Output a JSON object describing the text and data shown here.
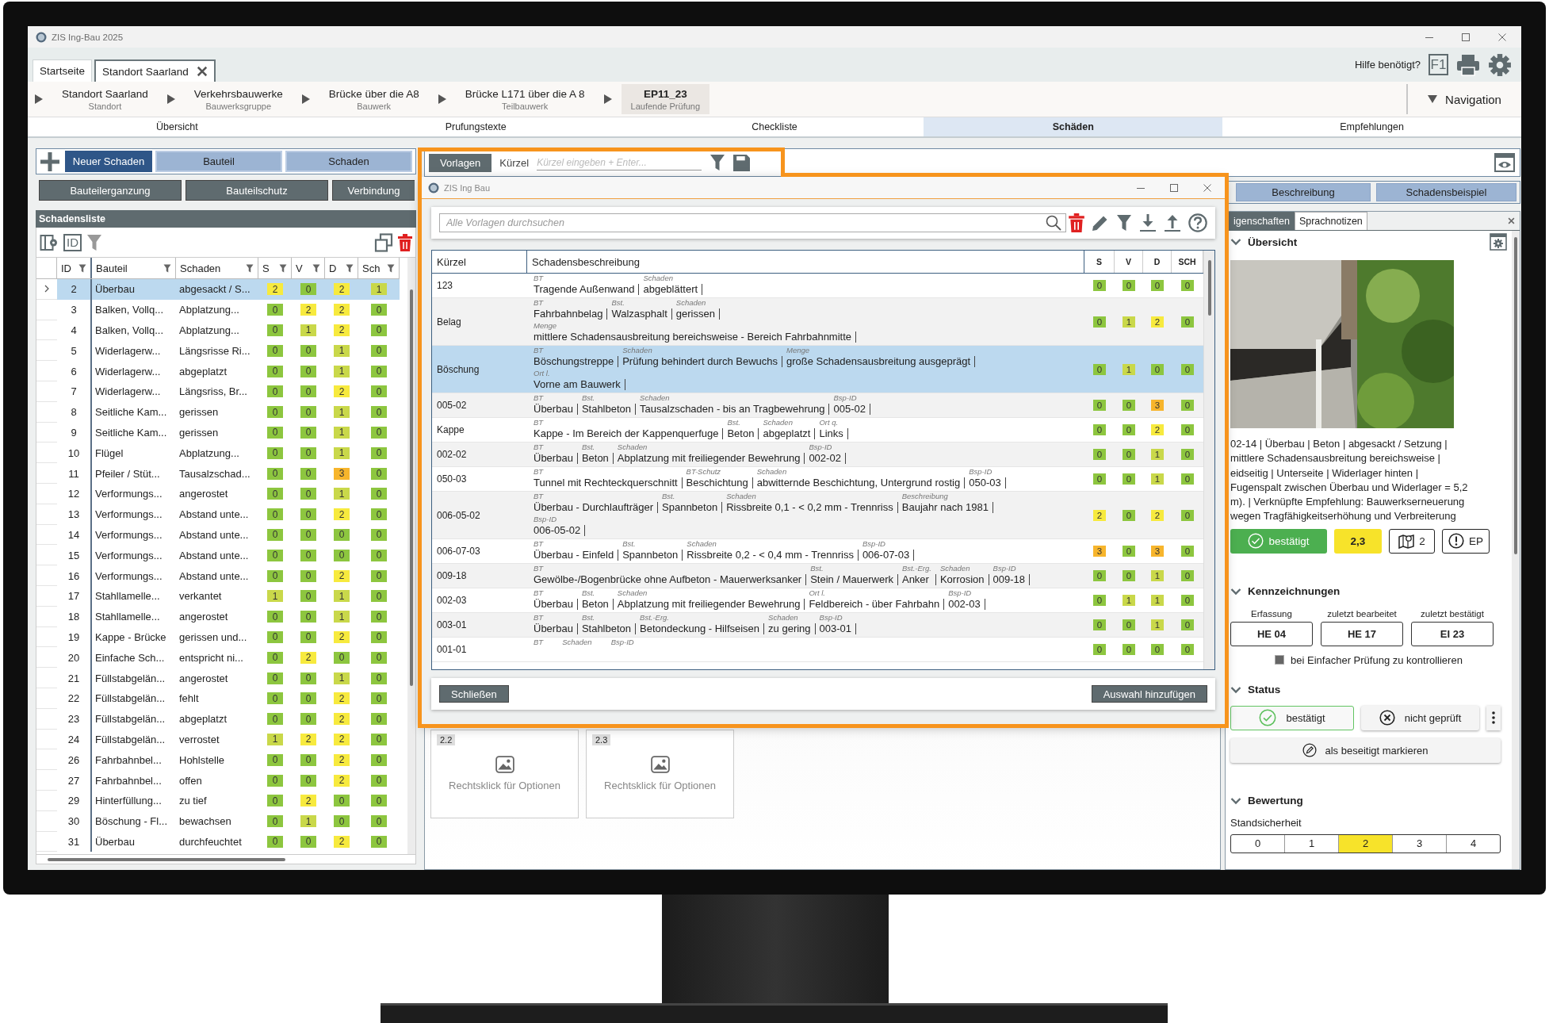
{
  "window": {
    "title": "ZIS Ing-Bau 2025"
  },
  "doc_tabs": [
    {
      "label": "Startseite",
      "selected": false,
      "closable": false
    },
    {
      "label": "Standort Saarland",
      "selected": true,
      "closable": true
    }
  ],
  "help": {
    "label": "Hilfe benötigt?",
    "key": "F1"
  },
  "breadcrumb": [
    {
      "title": "Standort Saarland",
      "subtitle": "Standort",
      "selected": false
    },
    {
      "title": "Verkehrsbauwerke",
      "subtitle": "Bauwerksgruppe",
      "selected": false
    },
    {
      "title": "Brücke über die A8",
      "subtitle": "Bauwerk",
      "selected": false
    },
    {
      "title": "Brücke L171 über die A 8",
      "subtitle": "Teilbauwerk",
      "selected": false
    },
    {
      "title": "EP11_23",
      "subtitle": "Laufende Prüfung",
      "selected": true
    }
  ],
  "navigation": {
    "label": "Navigation"
  },
  "nav_tabs": [
    {
      "label": "Übersicht",
      "selected": false
    },
    {
      "label": "Prufungstexte",
      "selected": false
    },
    {
      "label": "Checkliste",
      "selected": false
    },
    {
      "label": "Schäden",
      "selected": true
    },
    {
      "label": "Empfehlungen",
      "selected": false
    }
  ],
  "left_toolbar": {
    "primary": "Neuer Schaden",
    "row_1": [
      "Bauteil",
      "Schaden"
    ],
    "row_2": [
      "Bauteilerganzung",
      "Bauteilschutz",
      "Verbindung"
    ]
  },
  "damage_list": {
    "title": "Schadensliste",
    "id_toggle": "ID",
    "columns": [
      "ID",
      "Bauteil",
      "Schaden",
      "S",
      "V",
      "D",
      "Sch"
    ],
    "rows": [
      {
        "id": "2",
        "bauteil": "Überbau",
        "schaden": "abgesackt / S...",
        "selected": true,
        "ratings": [
          {
            "value": "2",
            "color": "#f7ea3e"
          },
          {
            "value": "0",
            "color": "#8dc63f"
          },
          {
            "value": "2",
            "color": "#f7ea3e"
          },
          {
            "value": "1",
            "color": "#c9d84a"
          }
        ]
      },
      {
        "id": "3",
        "bauteil": "Balken, Vollq...",
        "schaden": "Abplatzung...",
        "selected": false,
        "ratings": [
          {
            "value": "0",
            "color": "#8dc63f"
          },
          {
            "value": "2",
            "color": "#f7ea3e"
          },
          {
            "value": "2",
            "color": "#f7ea3e"
          },
          {
            "value": "0",
            "color": "#8dc63f"
          }
        ]
      },
      {
        "id": "4",
        "bauteil": "Balken, Vollq...",
        "schaden": "Abplatzung...",
        "selected": false,
        "ratings": [
          {
            "value": "0",
            "color": "#8dc63f"
          },
          {
            "value": "1",
            "color": "#c9d84a"
          },
          {
            "value": "2",
            "color": "#f7ea3e"
          },
          {
            "value": "0",
            "color": "#8dc63f"
          }
        ]
      },
      {
        "id": "5",
        "bauteil": "Widerlagerw...",
        "schaden": "Längsrisse Ri...",
        "selected": false,
        "ratings": [
          {
            "value": "0",
            "color": "#8dc63f"
          },
          {
            "value": "0",
            "color": "#8dc63f"
          },
          {
            "value": "1",
            "color": "#c9d84a"
          },
          {
            "value": "0",
            "color": "#8dc63f"
          }
        ]
      },
      {
        "id": "6",
        "bauteil": "Widerlagerw...",
        "schaden": "abgeplatzt",
        "selected": false,
        "ratings": [
          {
            "value": "0",
            "color": "#8dc63f"
          },
          {
            "value": "0",
            "color": "#8dc63f"
          },
          {
            "value": "1",
            "color": "#c9d84a"
          },
          {
            "value": "0",
            "color": "#8dc63f"
          }
        ]
      },
      {
        "id": "7",
        "bauteil": "Widerlagerw...",
        "schaden": "Längsriss, Br...",
        "selected": false,
        "ratings": [
          {
            "value": "0",
            "color": "#8dc63f"
          },
          {
            "value": "0",
            "color": "#8dc63f"
          },
          {
            "value": "2",
            "color": "#f7ea3e"
          },
          {
            "value": "0",
            "color": "#8dc63f"
          }
        ]
      },
      {
        "id": "8",
        "bauteil": "Seitliche Kam...",
        "schaden": "gerissen",
        "selected": false,
        "ratings": [
          {
            "value": "0",
            "color": "#8dc63f"
          },
          {
            "value": "0",
            "color": "#8dc63f"
          },
          {
            "value": "1",
            "color": "#c9d84a"
          },
          {
            "value": "0",
            "color": "#8dc63f"
          }
        ]
      },
      {
        "id": "9",
        "bauteil": "Seitliche Kam...",
        "schaden": "gerissen",
        "selected": false,
        "ratings": [
          {
            "value": "0",
            "color": "#8dc63f"
          },
          {
            "value": "0",
            "color": "#8dc63f"
          },
          {
            "value": "1",
            "color": "#c9d84a"
          },
          {
            "value": "0",
            "color": "#8dc63f"
          }
        ]
      },
      {
        "id": "10",
        "bauteil": "Flügel",
        "schaden": "Abplatzung...",
        "selected": false,
        "ratings": [
          {
            "value": "0",
            "color": "#8dc63f"
          },
          {
            "value": "0",
            "color": "#8dc63f"
          },
          {
            "value": "1",
            "color": "#c9d84a"
          },
          {
            "value": "0",
            "color": "#8dc63f"
          }
        ]
      },
      {
        "id": "11",
        "bauteil": "Pfeiler / Stüt...",
        "schaden": "Tausalzschad...",
        "selected": false,
        "ratings": [
          {
            "value": "0",
            "color": "#8dc63f"
          },
          {
            "value": "0",
            "color": "#8dc63f"
          },
          {
            "value": "3",
            "color": "#f7b52c"
          },
          {
            "value": "0",
            "color": "#8dc63f"
          }
        ]
      },
      {
        "id": "12",
        "bauteil": "Verformungs...",
        "schaden": "angerostet",
        "selected": false,
        "ratings": [
          {
            "value": "0",
            "color": "#8dc63f"
          },
          {
            "value": "0",
            "color": "#8dc63f"
          },
          {
            "value": "1",
            "color": "#c9d84a"
          },
          {
            "value": "0",
            "color": "#8dc63f"
          }
        ]
      },
      {
        "id": "13",
        "bauteil": "Verformungs...",
        "schaden": "Abstand unte...",
        "selected": false,
        "ratings": [
          {
            "value": "0",
            "color": "#8dc63f"
          },
          {
            "value": "0",
            "color": "#8dc63f"
          },
          {
            "value": "2",
            "color": "#f7ea3e"
          },
          {
            "value": "0",
            "color": "#8dc63f"
          }
        ]
      },
      {
        "id": "14",
        "bauteil": "Verformungs...",
        "schaden": "Abstand unte...",
        "selected": false,
        "ratings": [
          {
            "value": "0",
            "color": "#8dc63f"
          },
          {
            "value": "0",
            "color": "#8dc63f"
          },
          {
            "value": "0",
            "color": "#8dc63f"
          },
          {
            "value": "0",
            "color": "#8dc63f"
          }
        ]
      },
      {
        "id": "15",
        "bauteil": "Verformungs...",
        "schaden": "Abstand unte...",
        "selected": false,
        "ratings": [
          {
            "value": "0",
            "color": "#8dc63f"
          },
          {
            "value": "0",
            "color": "#8dc63f"
          },
          {
            "value": "0",
            "color": "#8dc63f"
          },
          {
            "value": "0",
            "color": "#8dc63f"
          }
        ]
      },
      {
        "id": "16",
        "bauteil": "Verformungs...",
        "schaden": "Abstand unte...",
        "selected": false,
        "ratings": [
          {
            "value": "0",
            "color": "#8dc63f"
          },
          {
            "value": "0",
            "color": "#8dc63f"
          },
          {
            "value": "2",
            "color": "#f7ea3e"
          },
          {
            "value": "0",
            "color": "#8dc63f"
          }
        ]
      },
      {
        "id": "17",
        "bauteil": "Stahllamelle...",
        "schaden": "verkantet",
        "selected": false,
        "ratings": [
          {
            "value": "1",
            "color": "#c9d84a"
          },
          {
            "value": "0",
            "color": "#8dc63f"
          },
          {
            "value": "1",
            "color": "#c9d84a"
          },
          {
            "value": "0",
            "color": "#8dc63f"
          }
        ]
      },
      {
        "id": "18",
        "bauteil": "Stahllamelle...",
        "schaden": "angerostet",
        "selected": false,
        "ratings": [
          {
            "value": "0",
            "color": "#8dc63f"
          },
          {
            "value": "0",
            "color": "#8dc63f"
          },
          {
            "value": "1",
            "color": "#c9d84a"
          },
          {
            "value": "0",
            "color": "#8dc63f"
          }
        ]
      },
      {
        "id": "19",
        "bauteil": "Kappe - Brücke",
        "schaden": "gerissen und...",
        "selected": false,
        "ratings": [
          {
            "value": "0",
            "color": "#8dc63f"
          },
          {
            "value": "0",
            "color": "#8dc63f"
          },
          {
            "value": "2",
            "color": "#f7ea3e"
          },
          {
            "value": "0",
            "color": "#8dc63f"
          }
        ]
      },
      {
        "id": "20",
        "bauteil": "Einfache Sch...",
        "schaden": "entspricht ni...",
        "selected": false,
        "ratings": [
          {
            "value": "0",
            "color": "#8dc63f"
          },
          {
            "value": "2",
            "color": "#f7ea3e"
          },
          {
            "value": "0",
            "color": "#8dc63f"
          },
          {
            "value": "0",
            "color": "#8dc63f"
          }
        ]
      },
      {
        "id": "21",
        "bauteil": "Füllstabgelän...",
        "schaden": "angerostet",
        "selected": false,
        "ratings": [
          {
            "value": "0",
            "color": "#8dc63f"
          },
          {
            "value": "0",
            "color": "#8dc63f"
          },
          {
            "value": "1",
            "color": "#c9d84a"
          },
          {
            "value": "0",
            "color": "#8dc63f"
          }
        ]
      },
      {
        "id": "22",
        "bauteil": "Füllstabgelän...",
        "schaden": "fehlt",
        "selected": false,
        "ratings": [
          {
            "value": "0",
            "color": "#8dc63f"
          },
          {
            "value": "0",
            "color": "#8dc63f"
          },
          {
            "value": "2",
            "color": "#f7ea3e"
          },
          {
            "value": "0",
            "color": "#8dc63f"
          }
        ]
      },
      {
        "id": "23",
        "bauteil": "Füllstabgelän...",
        "schaden": "abgeplatzt",
        "selected": false,
        "ratings": [
          {
            "value": "0",
            "color": "#8dc63f"
          },
          {
            "value": "0",
            "color": "#8dc63f"
          },
          {
            "value": "2",
            "color": "#f7ea3e"
          },
          {
            "value": "0",
            "color": "#8dc63f"
          }
        ]
      },
      {
        "id": "24",
        "bauteil": "Füllstabgelän...",
        "schaden": "verrostet",
        "selected": false,
        "ratings": [
          {
            "value": "1",
            "color": "#c9d84a"
          },
          {
            "value": "2",
            "color": "#f7ea3e"
          },
          {
            "value": "2",
            "color": "#f7ea3e"
          },
          {
            "value": "0",
            "color": "#8dc63f"
          }
        ]
      },
      {
        "id": "26",
        "bauteil": "Fahrbahnbel...",
        "schaden": "Hohlstelle",
        "selected": false,
        "ratings": [
          {
            "value": "0",
            "color": "#8dc63f"
          },
          {
            "value": "0",
            "color": "#8dc63f"
          },
          {
            "value": "2",
            "color": "#f7ea3e"
          },
          {
            "value": "0",
            "color": "#8dc63f"
          }
        ]
      },
      {
        "id": "27",
        "bauteil": "Fahrbahnbel...",
        "schaden": "offen",
        "selected": false,
        "ratings": [
          {
            "value": "0",
            "color": "#8dc63f"
          },
          {
            "value": "0",
            "color": "#8dc63f"
          },
          {
            "value": "2",
            "color": "#f7ea3e"
          },
          {
            "value": "0",
            "color": "#8dc63f"
          }
        ]
      },
      {
        "id": "29",
        "bauteil": "Hinterfüllung...",
        "schaden": "zu tief",
        "selected": false,
        "ratings": [
          {
            "value": "0",
            "color": "#8dc63f"
          },
          {
            "value": "2",
            "color": "#f7ea3e"
          },
          {
            "value": "0",
            "color": "#8dc63f"
          },
          {
            "value": "0",
            "color": "#8dc63f"
          }
        ]
      },
      {
        "id": "30",
        "bauteil": "Böschung - Fl...",
        "schaden": "bewachsen",
        "selected": false,
        "ratings": [
          {
            "value": "0",
            "color": "#8dc63f"
          },
          {
            "value": "1",
            "color": "#c9d84a"
          },
          {
            "value": "0",
            "color": "#8dc63f"
          },
          {
            "value": "0",
            "color": "#8dc63f"
          }
        ]
      },
      {
        "id": "31",
        "bauteil": "Überbau",
        "schaden": "durchfeuchtet",
        "selected": false,
        "ratings": [
          {
            "value": "0",
            "color": "#8dc63f"
          },
          {
            "value": "0",
            "color": "#8dc63f"
          },
          {
            "value": "2",
            "color": "#f7ea3e"
          },
          {
            "value": "0",
            "color": "#8dc63f"
          }
        ]
      }
    ]
  },
  "templates_bar": {
    "tab": "Vorlagen",
    "label": "Kürzel",
    "placeholder": "Kürzel eingeben + Enter..."
  },
  "detail_buttons": [
    "Beschreibung",
    "Schadensbeispiel"
  ],
  "image_slots": [
    {
      "number": "2.2",
      "hint": "Rechtsklick für Optionen"
    },
    {
      "number": "2.3",
      "hint": "Rechtsklick für Optionen"
    }
  ],
  "dialog": {
    "title": "ZIS Ing Bau",
    "search_placeholder": "Alle Vorlagen durchsuchen",
    "columns": [
      "Kürzel",
      "Schadensbeschreibung",
      "S",
      "V",
      "D",
      "SCH"
    ],
    "rows": [
      {
        "kuerzel": "123",
        "selected": false,
        "lines": [
          [
            {
              "label": "BT",
              "text": "Tragende Außenwand"
            },
            {
              "label": "Schaden",
              "text": "abgeblättert"
            }
          ]
        ],
        "ratings": [
          {
            "value": "0",
            "color": "#8dc63f"
          },
          {
            "value": "0",
            "color": "#8dc63f"
          },
          {
            "value": "0",
            "color": "#8dc63f"
          },
          {
            "value": "0",
            "color": "#8dc63f"
          }
        ]
      },
      {
        "kuerzel": "Belag",
        "selected": false,
        "lines": [
          [
            {
              "label": "BT",
              "text": "Fahrbahnbelag"
            },
            {
              "label": "Bst.",
              "text": "Walzasphalt"
            },
            {
              "label": "Schaden",
              "text": "gerissen"
            }
          ],
          [
            {
              "label": "Menge",
              "text": "mittlere Schadensausbreitung bereichsweise - Bereich Fahrbahnmitte"
            }
          ]
        ],
        "ratings": [
          {
            "value": "0",
            "color": "#8dc63f"
          },
          {
            "value": "1",
            "color": "#c9d84a"
          },
          {
            "value": "2",
            "color": "#f7ea3e"
          },
          {
            "value": "0",
            "color": "#8dc63f"
          }
        ]
      },
      {
        "kuerzel": "Böschung",
        "selected": true,
        "lines": [
          [
            {
              "label": "BT",
              "text": "Böschungstreppe"
            },
            {
              "label": "Schaden",
              "text": "Prüfung behindert durch Bewuchs"
            },
            {
              "label": "Menge",
              "text": "große Schadensausbreitung ausgeprägt"
            }
          ],
          [
            {
              "label": "Ort l.",
              "text": "Vorne am Bauwerk"
            }
          ]
        ],
        "ratings": [
          {
            "value": "0",
            "color": "#8dc63f"
          },
          {
            "value": "1",
            "color": "#c9d84a"
          },
          {
            "value": "0",
            "color": "#8dc63f"
          },
          {
            "value": "0",
            "color": "#8dc63f"
          }
        ]
      },
      {
        "kuerzel": "005-02",
        "selected": false,
        "lines": [
          [
            {
              "label": "BT",
              "text": "Überbau"
            },
            {
              "label": "Bst.",
              "text": "Stahlbeton"
            },
            {
              "label": "Schaden",
              "text": "Tausalzschaden - bis an Tragbewehrung"
            },
            {
              "label": "Bsp-ID",
              "text": "005-02"
            }
          ]
        ],
        "ratings": [
          {
            "value": "0",
            "color": "#8dc63f"
          },
          {
            "value": "0",
            "color": "#8dc63f"
          },
          {
            "value": "3",
            "color": "#f7b52c"
          },
          {
            "value": "0",
            "color": "#8dc63f"
          }
        ]
      },
      {
        "kuerzel": "Kappe",
        "selected": false,
        "lines": [
          [
            {
              "label": "BT",
              "text": "Kappe - Im Bereich der Kappenquerfuge"
            },
            {
              "label": "Bst.",
              "text": "Beton"
            },
            {
              "label": "Schaden",
              "text": "abgeplatzt"
            },
            {
              "label": "Ort q.",
              "text": "Links"
            }
          ]
        ],
        "ratings": [
          {
            "value": "0",
            "color": "#8dc63f"
          },
          {
            "value": "0",
            "color": "#8dc63f"
          },
          {
            "value": "2",
            "color": "#f7ea3e"
          },
          {
            "value": "0",
            "color": "#8dc63f"
          }
        ]
      },
      {
        "kuerzel": "002-02",
        "selected": false,
        "lines": [
          [
            {
              "label": "BT",
              "text": "Überbau"
            },
            {
              "label": "Bst.",
              "text": "Beton"
            },
            {
              "label": "Schaden",
              "text": "Abplatzung mit freiliegender Bewehrung"
            },
            {
              "label": "Bsp-ID",
              "text": "002-02"
            }
          ]
        ],
        "ratings": [
          {
            "value": "0",
            "color": "#8dc63f"
          },
          {
            "value": "0",
            "color": "#8dc63f"
          },
          {
            "value": "1",
            "color": "#c9d84a"
          },
          {
            "value": "0",
            "color": "#8dc63f"
          }
        ]
      },
      {
        "kuerzel": "050-03",
        "selected": false,
        "lines": [
          [
            {
              "label": "BT",
              "text": "Tunnel mit Rechteckquerschnitt"
            },
            {
              "label": "BT-Schutz",
              "text": "Beschichtung"
            },
            {
              "label": "Schaden",
              "text": "abwitternde Beschichtung, Untergrund rostig"
            },
            {
              "label": "Bsp-ID",
              "text": "050-03"
            }
          ]
        ],
        "ratings": [
          {
            "value": "0",
            "color": "#8dc63f"
          },
          {
            "value": "0",
            "color": "#8dc63f"
          },
          {
            "value": "1",
            "color": "#c9d84a"
          },
          {
            "value": "0",
            "color": "#8dc63f"
          }
        ]
      },
      {
        "kuerzel": "006-05-02",
        "selected": false,
        "lines": [
          [
            {
              "label": "BT",
              "text": "Überbau - Durchlaufträger"
            },
            {
              "label": "Bst.",
              "text": "Spannbeton"
            },
            {
              "label": "Schaden",
              "text": "Rissbreite 0,1 - < 0,2 mm - Trennriss"
            },
            {
              "label": "Beschreibung",
              "text": "Baujahr nach 1981"
            }
          ],
          [
            {
              "label": "Bsp-ID",
              "text": "006-05-02"
            }
          ]
        ],
        "ratings": [
          {
            "value": "2",
            "color": "#f7ea3e"
          },
          {
            "value": "0",
            "color": "#8dc63f"
          },
          {
            "value": "2",
            "color": "#f7ea3e"
          },
          {
            "value": "0",
            "color": "#8dc63f"
          }
        ]
      },
      {
        "kuerzel": "006-07-03",
        "selected": false,
        "lines": [
          [
            {
              "label": "BT",
              "text": "Überbau - Einfeld"
            },
            {
              "label": "Bst.",
              "text": "Spannbeton"
            },
            {
              "label": "Schaden",
              "text": "Rissbreite 0,2 - < 0,4 mm - Trennriss"
            },
            {
              "label": "Bsp-ID",
              "text": "006-07-03"
            }
          ]
        ],
        "ratings": [
          {
            "value": "3",
            "color": "#f7b52c"
          },
          {
            "value": "0",
            "color": "#8dc63f"
          },
          {
            "value": "3",
            "color": "#f7b52c"
          },
          {
            "value": "0",
            "color": "#8dc63f"
          }
        ]
      },
      {
        "kuerzel": "009-18",
        "selected": false,
        "lines": [
          [
            {
              "label": "BT",
              "text": "Gewölbe-/Bogenbrücke ohne Aufbeton - Mauerwerksanker"
            },
            {
              "label": "Bst.",
              "text": "Stein / Mauerwerk"
            },
            {
              "label": "Bst.-Erg.",
              "text": "Anker"
            },
            {
              "label": "Schaden",
              "text": "Korrosion"
            },
            {
              "label": "Bsp-ID",
              "text": "009-18"
            }
          ]
        ],
        "ratings": [
          {
            "value": "0",
            "color": "#8dc63f"
          },
          {
            "value": "0",
            "color": "#8dc63f"
          },
          {
            "value": "1",
            "color": "#c9d84a"
          },
          {
            "value": "0",
            "color": "#8dc63f"
          }
        ]
      },
      {
        "kuerzel": "002-03",
        "selected": false,
        "lines": [
          [
            {
              "label": "BT",
              "text": "Überbau"
            },
            {
              "label": "Bst.",
              "text": "Beton"
            },
            {
              "label": "Schaden",
              "text": "Abplatzung mit freiliegender Bewehrung"
            },
            {
              "label": "Ort l.",
              "text": "Feldbereich - über Fahrbahn"
            },
            {
              "label": "Bsp-ID",
              "text": "002-03"
            }
          ]
        ],
        "ratings": [
          {
            "value": "0",
            "color": "#8dc63f"
          },
          {
            "value": "1",
            "color": "#c9d84a"
          },
          {
            "value": "1",
            "color": "#c9d84a"
          },
          {
            "value": "0",
            "color": "#8dc63f"
          }
        ]
      },
      {
        "kuerzel": "003-01",
        "selected": false,
        "lines": [
          [
            {
              "label": "BT",
              "text": "Überbau"
            },
            {
              "label": "Bst.",
              "text": "Stahlbeton"
            },
            {
              "label": "Bst.-Erg.",
              "text": "Betondeckung - Hilfseisen"
            },
            {
              "label": "Schaden",
              "text": "zu gering"
            },
            {
              "label": "Bsp-ID",
              "text": "003-01"
            }
          ]
        ],
        "ratings": [
          {
            "value": "0",
            "color": "#8dc63f"
          },
          {
            "value": "0",
            "color": "#8dc63f"
          },
          {
            "value": "1",
            "color": "#c9d84a"
          },
          {
            "value": "0",
            "color": "#8dc63f"
          }
        ]
      },
      {
        "kuerzel": "001-01",
        "selected": false,
        "lines": [
          [
            {
              "label": "BT"
            },
            {
              "label": "Schaden"
            },
            {
              "label": "Bsp-ID"
            }
          ]
        ],
        "ratings": [
          {
            "value": "0",
            "color": "#8dc63f"
          },
          {
            "value": "0",
            "color": "#8dc63f"
          },
          {
            "value": "0",
            "color": "#8dc63f"
          },
          {
            "value": "0",
            "color": "#8dc63f"
          }
        ]
      }
    ],
    "close_button": "Schließen",
    "add_button": "Auswahl hinzufügen"
  },
  "properties": {
    "tabs": [
      {
        "label": "igenschaften",
        "selected": true
      },
      {
        "label": "Sprachnotizen",
        "selected": false
      }
    ],
    "overview": {
      "title": "Übersicht",
      "expanded": true,
      "description": [
        "02-14 | Überbau | Beton | abgesackt / Setzung |",
        "mittlere Schadensausbreitung bereichsweise |",
        "eidseitig | Unterseite | Widerlager hinten |",
        "Fugenspalt zwischen Überbau und Widerlager = 5,2",
        "m). | Verknüpfte Empfehlung: Bauwerkserneuerung",
        "wegen Tragfähigkeitserhöhung  und Verbreiterung"
      ],
      "status_badge": "bestätigt",
      "score": "2,3",
      "locations": "2",
      "ep": "EP"
    },
    "markings": {
      "title": "Kennzeichnungen",
      "expanded": true,
      "fields": [
        {
          "label": "Erfassung",
          "value": "HE 04"
        },
        {
          "label": "zuletzt bearbeitet",
          "value": "HE 17"
        },
        {
          "label": "zuletzt bestätigt",
          "value": "EI 23"
        }
      ],
      "checkbox": {
        "label": "bei Einfacher Prüfung zu kontrollieren",
        "checked": true
      }
    },
    "status": {
      "title": "Status",
      "expanded": true,
      "buttons": [
        {
          "label": "bestätigt",
          "selected": true,
          "kind": "check"
        },
        {
          "label": "nicht geprüft",
          "selected": false,
          "kind": "cross"
        }
      ],
      "remove_button": "als beseitigt markieren"
    },
    "rating": {
      "title": "Bewertung",
      "expanded": true,
      "label": "Standsicherheit",
      "scale": [
        {
          "label": "0",
          "selected": false
        },
        {
          "label": "1",
          "selected": false
        },
        {
          "label": "2",
          "selected": true
        },
        {
          "label": "3",
          "selected": false
        },
        {
          "label": "4",
          "selected": false
        }
      ]
    }
  }
}
